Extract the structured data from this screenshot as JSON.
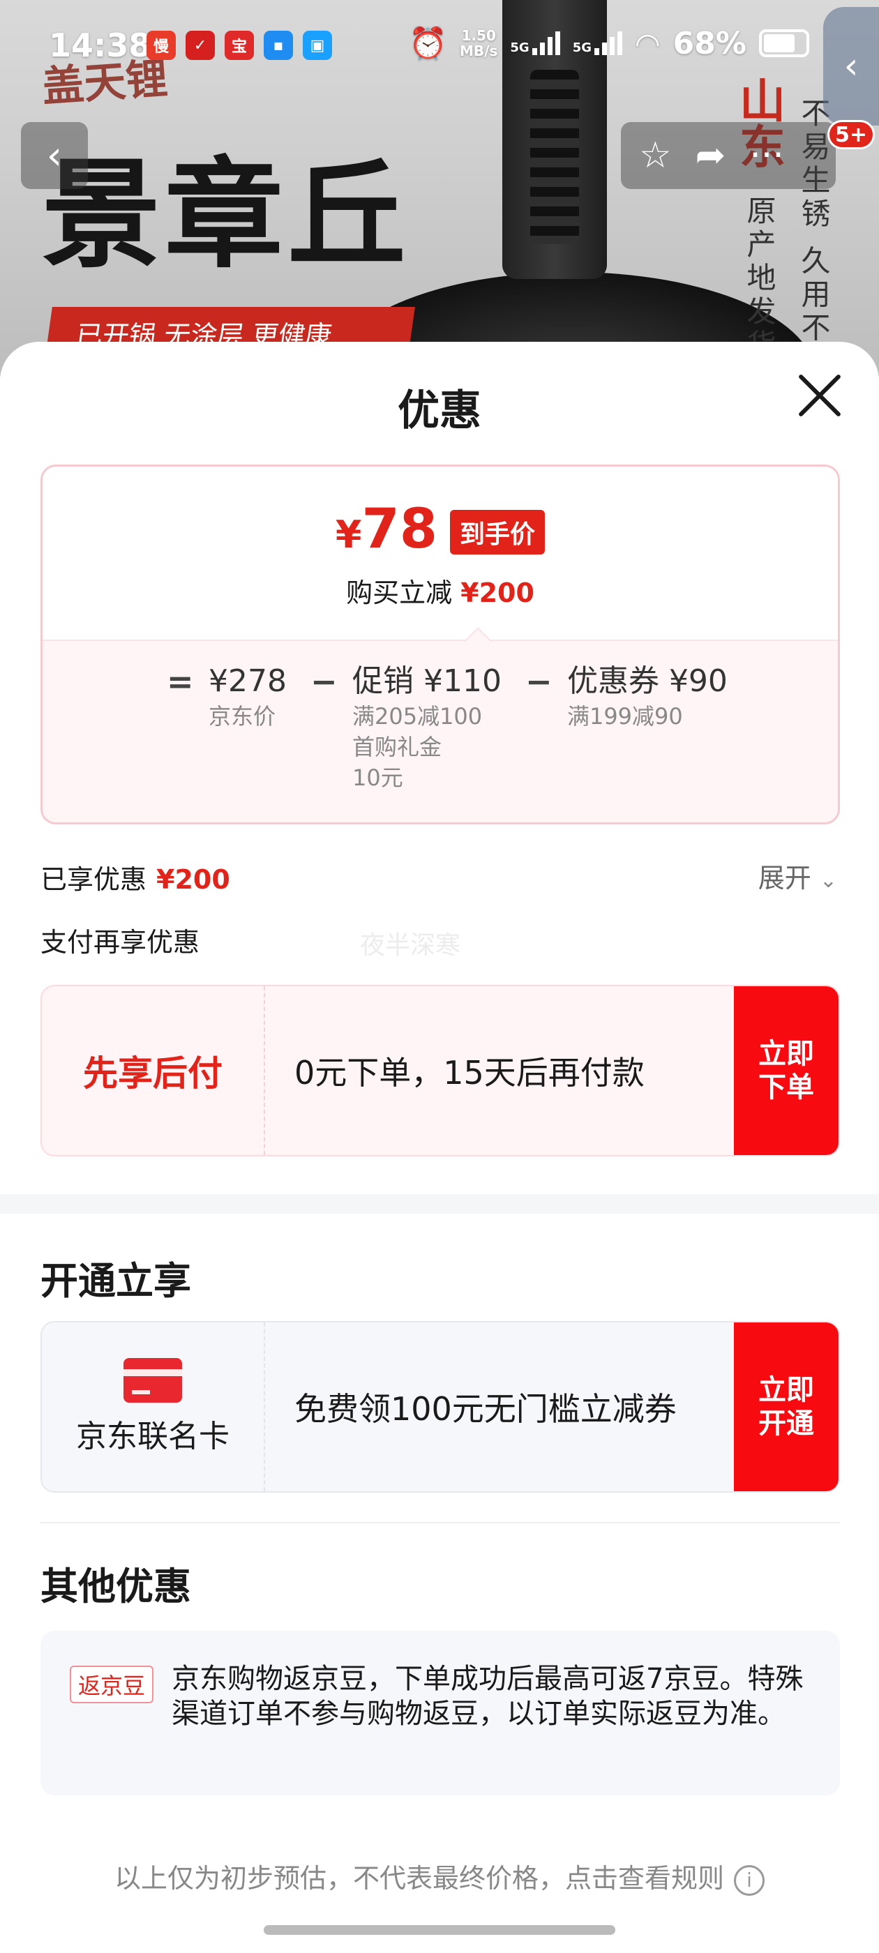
{
  "status": {
    "time": "14:38",
    "speed_top": "1.50",
    "speed_bottom": "MB/s",
    "net1": "5G",
    "net2": "5G",
    "battery": "68%",
    "apps": [
      {
        "glyph": "慢",
        "color": "#e83b2a"
      },
      {
        "glyph": "✓",
        "color": "#d61f1f"
      },
      {
        "glyph": "宝",
        "color": "#e02a2a"
      },
      {
        "glyph": "▪",
        "color": "#1e8cf0"
      },
      {
        "glyph": "▣",
        "color": "#1aa0ff"
      }
    ]
  },
  "banner": {
    "brand": "盖天锂",
    "title": "章丘",
    "title_prefix": "景",
    "strip": "已开锅 无涂层 更健康",
    "shan": "山东",
    "vert1": "原产地发货",
    "vert2": "不易生锈 久用不"
  },
  "nav": {
    "back_glyph": "‹",
    "star_glyph": "☆",
    "share_glyph": "➦",
    "more_glyph": "···",
    "badge": "5+",
    "side_tab_glyph": "‹"
  },
  "sheet": {
    "title": "优惠",
    "price": {
      "currency": "¥",
      "final": "78",
      "final_tag": "到手价",
      "reduce_label": "购买立减",
      "reduce_amount": "¥200",
      "equals": "=",
      "minus": "−",
      "terms": [
        {
          "value": "¥278",
          "sub": [
            "京东价"
          ]
        },
        {
          "value": "促销 ¥110",
          "sub": [
            "满205减100",
            "首购礼金",
            "10元"
          ]
        },
        {
          "value": "优惠券 ¥90",
          "sub": [
            "满199减90"
          ]
        }
      ]
    },
    "enjoyed_label": "已享优惠",
    "enjoyed_amount": "¥200",
    "expand_label": "展开",
    "pay_title": "支付再享优惠",
    "watermark": "夜半深寒",
    "pay_offer": {
      "left": "先享后付",
      "mid": "0元下单，15天后再付款",
      "btn1": "立即",
      "btn2": "下单"
    },
    "open_title": "开通立享",
    "open_offer": {
      "left": "京东联名卡",
      "mid": "免费领100元无门槛立减券",
      "btn1": "立即",
      "btn2": "开通"
    },
    "other_title": "其他优惠",
    "other": {
      "tag": "返京豆",
      "text": "京东购物返京豆，下单成功后最高可返7京豆。特殊渠道订单不参与购物返豆，以订单实际返豆为准。"
    },
    "disclaimer": "以上仅为初步预估，不代表最终价格，点击查看规则",
    "info_glyph": "i"
  }
}
